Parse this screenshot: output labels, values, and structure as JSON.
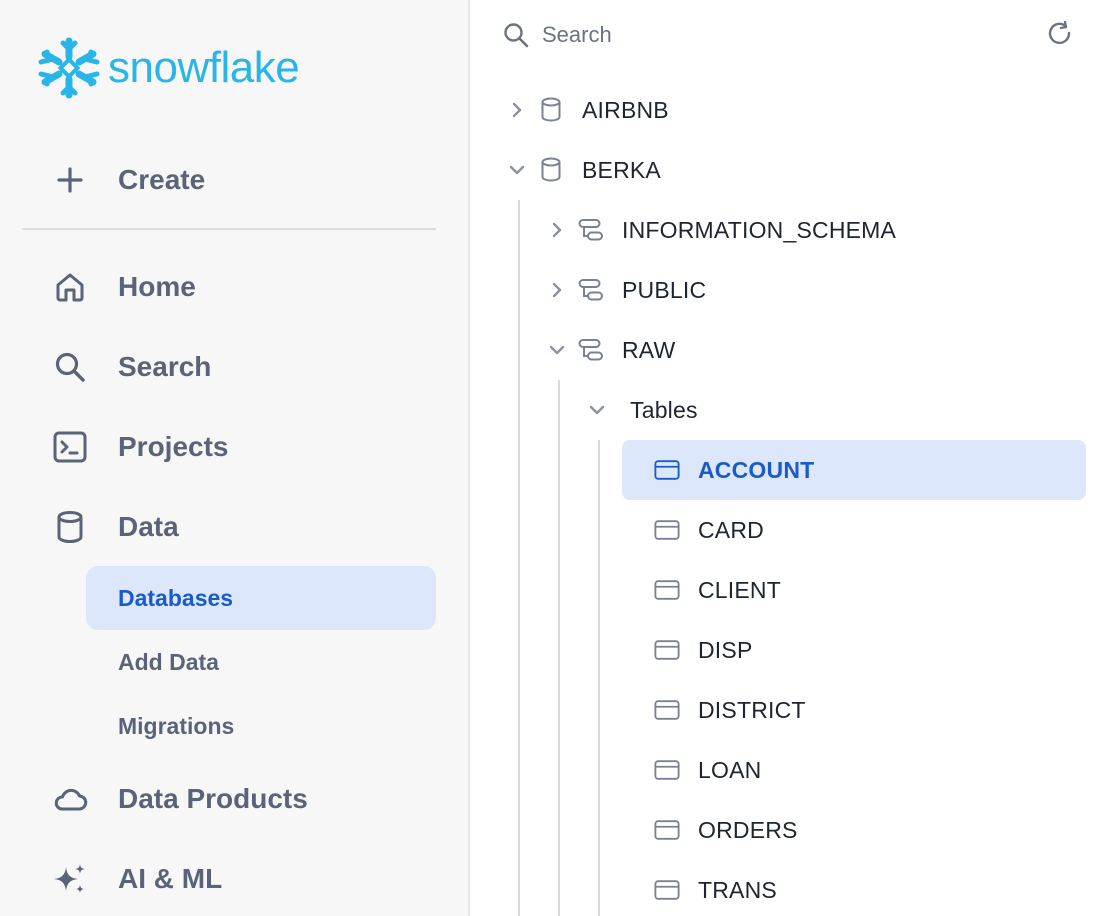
{
  "brand": {
    "logo_text": "snowflake",
    "accent": "#29b5e8"
  },
  "sidebar": {
    "create_label": "Create",
    "items": [
      {
        "label": "Home",
        "icon": "home-icon"
      },
      {
        "label": "Search",
        "icon": "search-icon"
      },
      {
        "label": "Projects",
        "icon": "terminal-icon"
      },
      {
        "label": "Data",
        "icon": "database-icon"
      }
    ],
    "data_subitems": [
      {
        "label": "Databases",
        "active": true
      },
      {
        "label": "Add Data",
        "active": false
      },
      {
        "label": "Migrations",
        "active": false
      }
    ],
    "bottom_items": [
      {
        "label": "Data Products",
        "icon": "cloud-icon"
      },
      {
        "label": "AI & ML",
        "icon": "sparkle-icon"
      }
    ]
  },
  "main": {
    "search_placeholder": "Search",
    "tree": {
      "databases": [
        {
          "label": "AIRBNB",
          "expanded": false
        },
        {
          "label": "BERKA",
          "expanded": true
        }
      ],
      "schemas": [
        {
          "label": "INFORMATION_SCHEMA",
          "expanded": false
        },
        {
          "label": "PUBLIC",
          "expanded": false
        },
        {
          "label": "RAW",
          "expanded": true
        }
      ],
      "group_label": "Tables",
      "tables": [
        {
          "label": "ACCOUNT",
          "selected": true
        },
        {
          "label": "CARD",
          "selected": false
        },
        {
          "label": "CLIENT",
          "selected": false
        },
        {
          "label": "DISP",
          "selected": false
        },
        {
          "label": "DISTRICT",
          "selected": false
        },
        {
          "label": "LOAN",
          "selected": false
        },
        {
          "label": "ORDERS",
          "selected": false
        },
        {
          "label": "TRANS",
          "selected": false
        }
      ]
    }
  },
  "colors": {
    "selected_bg": "#dce7fb",
    "selected_text": "#1a5bc9",
    "sidebar_bg": "#f7f7f7"
  }
}
